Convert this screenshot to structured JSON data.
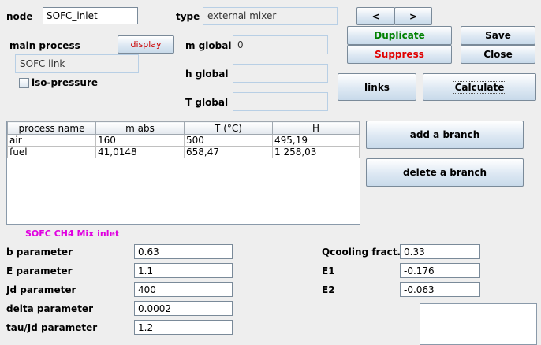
{
  "header": {
    "node_label": "node",
    "node_value": "SOFC_inlet",
    "type_label": "type",
    "type_value": "external mixer",
    "main_process_label": "main process",
    "display_label": "display",
    "main_process_value": "SOFC link",
    "iso_pressure_label": "iso-pressure",
    "m_global_label": "m global",
    "m_global_value": "0",
    "h_global_label": "h global",
    "h_global_value": "",
    "t_global_label": "T global",
    "t_global_value": ""
  },
  "nav": {
    "prev_label": "<",
    "next_label": ">"
  },
  "actions": {
    "duplicate_label": "Duplicate",
    "save_label": "Save",
    "suppress_label": "Suppress",
    "close_label": "Close",
    "links_label": "links",
    "calculate_label": "Calculate",
    "add_branch_label": "add a branch",
    "delete_branch_label": "delete a branch"
  },
  "table": {
    "columns": [
      "process name",
      "m abs",
      "T (°C)",
      "H"
    ],
    "rows": [
      [
        "air",
        "160",
        "500",
        "495,19"
      ],
      [
        "fuel",
        "41,0148",
        "658,47",
        "1 258,03"
      ]
    ]
  },
  "params": {
    "section_title": "SOFC CH4 Mix inlet",
    "left": [
      {
        "label": "b parameter",
        "value": "0.63"
      },
      {
        "label": "E parameter",
        "value": "1.1"
      },
      {
        "label": "Jd parameter",
        "value": "400"
      },
      {
        "label": "delta parameter",
        "value": "0.0002"
      },
      {
        "label": "tau/Jd parameter",
        "value": "1.2"
      }
    ],
    "right": [
      {
        "label": "Qcooling fract.",
        "value": "0.33"
      },
      {
        "label": "E1",
        "value": "-0.176"
      },
      {
        "label": "E2",
        "value": "-0.063"
      }
    ]
  },
  "colors": {
    "duplicate": "#008000",
    "suppress": "#e00000",
    "display": "#cc0000",
    "section_title": "#e000e0"
  }
}
